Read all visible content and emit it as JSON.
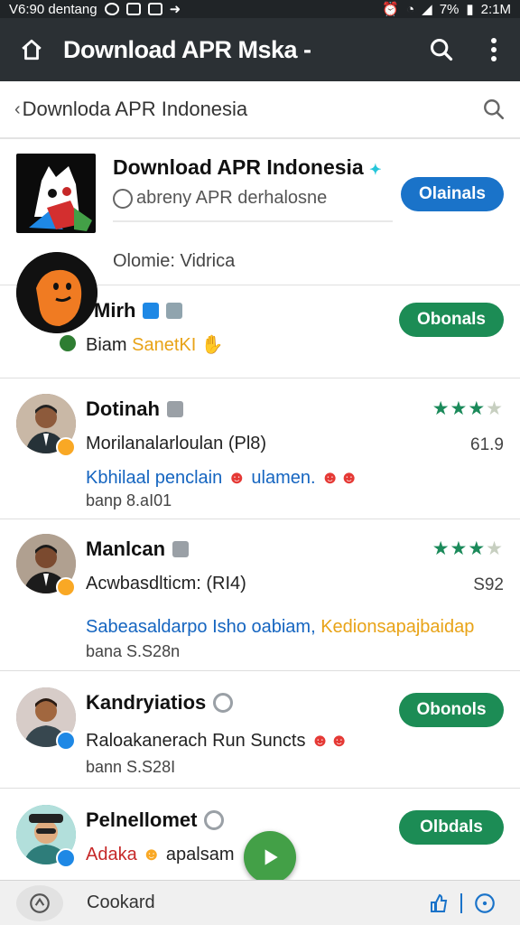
{
  "status_bar": {
    "left_text": "V6:90 dentang",
    "battery": "7%",
    "time": "2:1M"
  },
  "app_bar": {
    "title": "Download APR Mska -"
  },
  "search": {
    "query": "Downloda APR Indonesia"
  },
  "header_card": {
    "title": "Download APR Indonesia",
    "subtitle": "abreny APR derhalosne",
    "button": "Olainals",
    "meta": "Olomie: Vidrica"
  },
  "items": [
    {
      "name": "Mirh",
      "line1": "Biam",
      "line1_highlight": "SanetKI",
      "button": "Obonals"
    },
    {
      "name": "Dotinah",
      "line1": "Morilanalarloulan (Pl8)",
      "line2": "Kbhilaal penclain",
      "line2_tail": "ulamen.",
      "line3": "banp 8.aI01",
      "rating": 3,
      "rating_max": 4,
      "score": "61.9"
    },
    {
      "name": "Manlcan",
      "line1": "Acwbasdlticm: (RI4)",
      "line2": "Sabeasaldarpo Isho oabiam,",
      "line2_tail": "Kedionsapajbaidap",
      "line3": "bana S.S28n",
      "rating": 3,
      "rating_max": 4,
      "score": "S92"
    },
    {
      "name": "Kandryiatios",
      "line1": "Raloakanerach Run Suncts",
      "line3": "bann S.S28I",
      "button": "Obonols"
    },
    {
      "name": "Pelnellomet",
      "line1": "Adaka",
      "line1_tail": "apalsam",
      "button": "Olbdals"
    }
  ],
  "bottom_bar": {
    "label": "Cookard"
  },
  "colors": {
    "app_bar": "#2b3034",
    "blue_button": "#1a73c9",
    "green_button": "#1c8c55",
    "star": "#1b8a5a",
    "fab": "#43a047"
  }
}
